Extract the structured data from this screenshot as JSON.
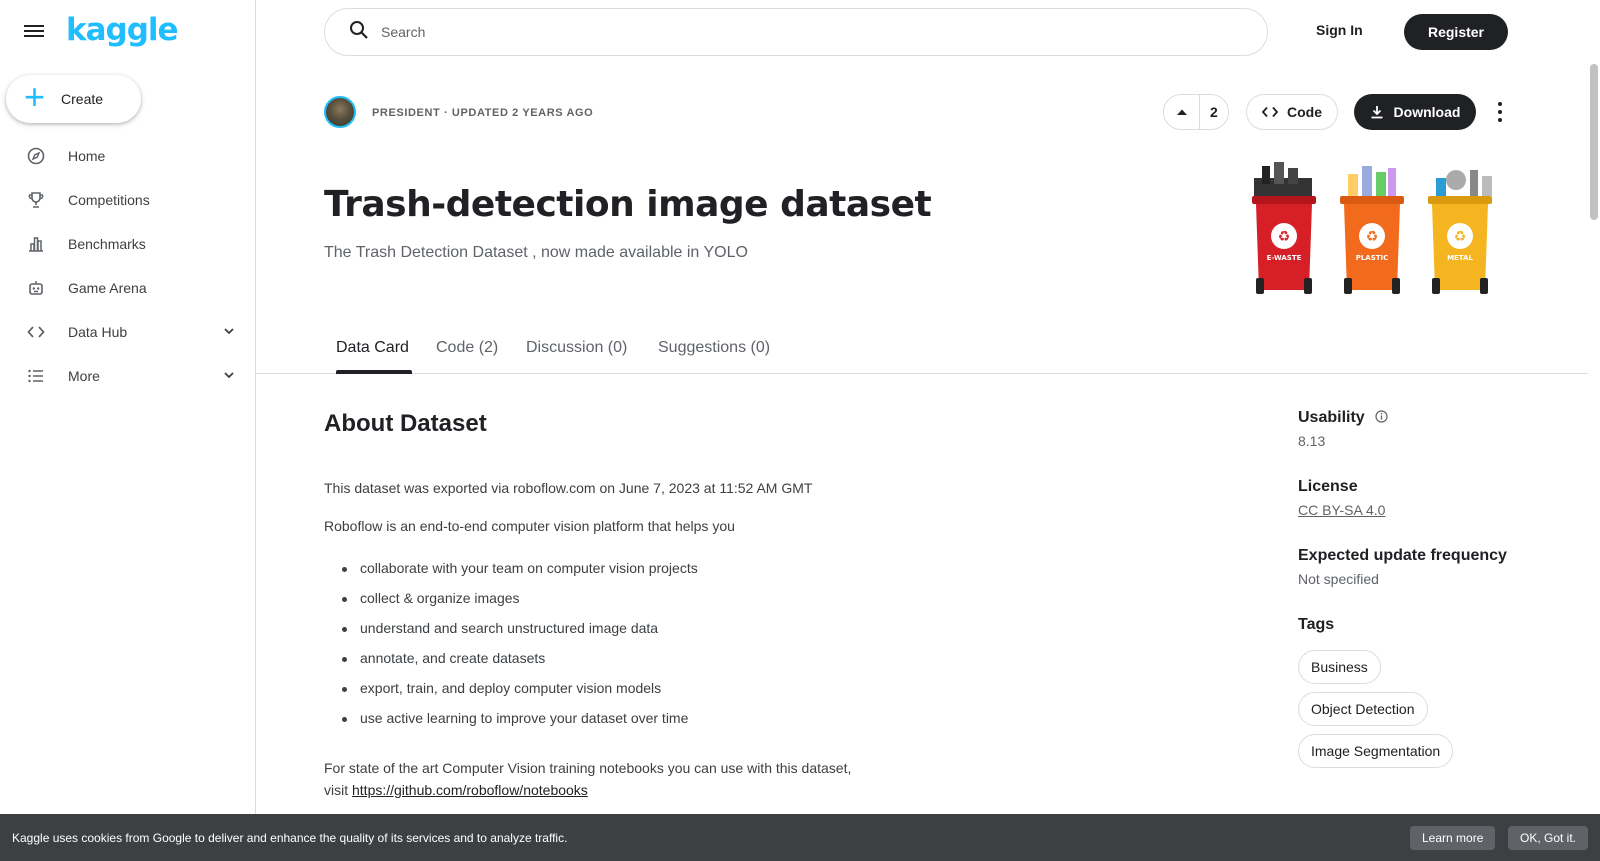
{
  "app": {
    "logo": "kaggle"
  },
  "sidebar": {
    "create_label": "Create",
    "items": [
      {
        "label": "Home",
        "icon": "compass-icon"
      },
      {
        "label": "Competitions",
        "icon": "trophy-icon"
      },
      {
        "label": "Benchmarks",
        "icon": "bar-chart-icon"
      },
      {
        "label": "Game Arena",
        "icon": "robot-icon"
      },
      {
        "label": "Data Hub",
        "icon": "code-icon"
      },
      {
        "label": "More",
        "icon": "list-icon"
      }
    ]
  },
  "topbar": {
    "search_placeholder": "Search",
    "signin_label": "Sign In",
    "register_label": "Register"
  },
  "dataset": {
    "meta": "PRESIDENT · UPDATED 2 YEARS AGO",
    "upvotes": "2",
    "code_label": "Code",
    "download_label": "Download",
    "title": "Trash-detection image dataset",
    "subtitle": "The Trash Detection Dataset , now made available in YOLO",
    "banner_bins": [
      {
        "label": "E-WASTE",
        "color": "#d61f26"
      },
      {
        "label": "PLASTIC",
        "color": "#f26b1d"
      },
      {
        "label": "METAL",
        "color": "#f5b521"
      }
    ]
  },
  "tabs": [
    "Data Card",
    "Code (2)",
    "Discussion (0)",
    "Suggestions (0)"
  ],
  "about": {
    "heading": "About Dataset",
    "para1": "This dataset was exported via roboflow.com on June 7, 2023 at 11:52 AM GMT",
    "para2": "Roboflow is an end-to-end computer vision platform that helps you",
    "bullets": [
      "collaborate with your team on computer vision projects",
      "collect & organize images",
      "understand and search unstructured image data",
      "annotate, and create datasets",
      "export, train, and deploy computer vision models",
      "use active learning to improve your dataset over time"
    ],
    "para3_line1": "For state of the art Computer Vision training notebooks you can use with this dataset,",
    "para3_prefix": "visit ",
    "para3_link": "https://github.com/roboflow/notebooks"
  },
  "details": {
    "usability_label": "Usability",
    "usability_value": "8.13",
    "license_label": "License",
    "license_value": "CC BY-SA 4.0",
    "frequency_label": "Expected update frequency",
    "frequency_value": "Not specified",
    "tags_label": "Tags",
    "tags": [
      "Business",
      "Object Detection",
      "Image Segmentation"
    ]
  },
  "cookie": {
    "text": "Kaggle uses cookies from Google to deliver and enhance the quality of its services and to analyze traffic.",
    "learn_more": "Learn more",
    "ok": "OK, Got it."
  },
  "colors": {
    "accent": "#20beff",
    "dark": "#202124"
  }
}
